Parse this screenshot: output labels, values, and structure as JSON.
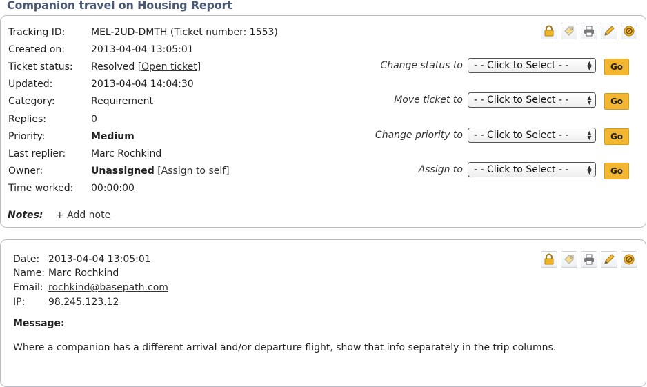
{
  "page": {
    "title": "Companion travel on Housing Report"
  },
  "ticket": {
    "tracking_label": "Tracking ID:",
    "tracking_value": "MEL-2UD-DMTH (Ticket number: 1553)",
    "created_label": "Created on:",
    "created_value": "2013-04-04 13:05:01",
    "status_label": "Ticket status:",
    "status_value": "Resolved",
    "status_link": "[Open ticket]",
    "updated_label": "Updated:",
    "updated_value": "2013-04-04 14:04:30",
    "category_label": "Category:",
    "category_value": "Requirement",
    "replies_label": "Replies:",
    "replies_value": "0",
    "priority_label": "Priority:",
    "priority_value": "Medium",
    "last_replier_label": "Last replier:",
    "last_replier_value": "Marc Rochkind",
    "owner_label": "Owner:",
    "owner_value": "Unassigned",
    "owner_link": "[Assign to self]",
    "time_label": "Time worked:",
    "time_value": "00:00:00",
    "notes_label": "Notes:",
    "add_note": "+ Add note"
  },
  "actions": {
    "change_status": "Change status to",
    "move_ticket": "Move ticket to",
    "change_priority": "Change priority to",
    "assign_to": "Assign to",
    "select_placeholder": "- - Click to Select - -",
    "go_label": "Go"
  },
  "toolbar_icons": [
    "lock-icon",
    "tag-icon",
    "print-icon",
    "edit-pencil-icon",
    "cancel-icon"
  ],
  "colors": {
    "accent": "#f2b630",
    "priority_medium": "#e9a21e",
    "title": "#4a5a75"
  },
  "message": {
    "date_label": "Date:",
    "date_value": "2013-04-04 13:05:01",
    "name_label": "Name:",
    "name_value": "Marc Rochkind",
    "email_label": "Email:",
    "email_value": "rochkind@basepath.com",
    "ip_label": "IP:",
    "ip_value": "98.245.123.12",
    "heading": "Message:",
    "body": "Where a companion has a different arrival and/or departure flight, show that info separately in the trip columns."
  }
}
